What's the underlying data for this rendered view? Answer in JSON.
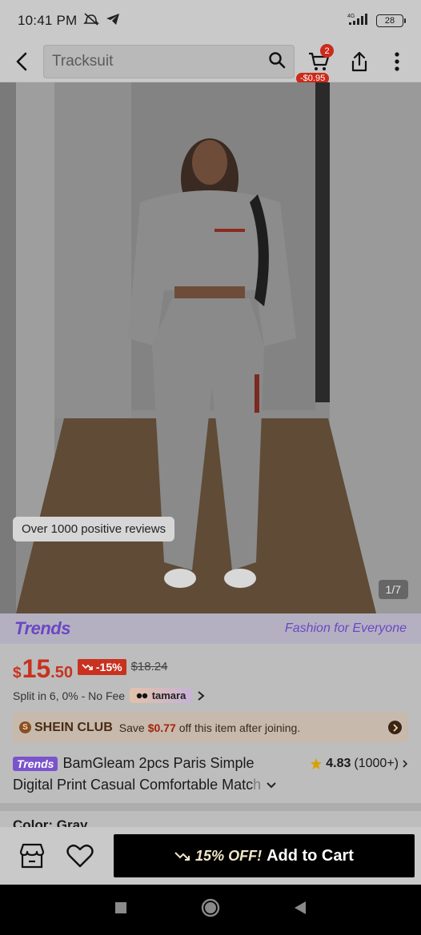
{
  "status_bar": {
    "time": "10:41 PM",
    "network": "4G",
    "battery": "28"
  },
  "search": {
    "query": "Tracksuit"
  },
  "cart": {
    "count": "2",
    "discount": "-$0.95"
  },
  "gallery": {
    "review_chip": "Over 1000 positive reviews",
    "page_indicator": "1/7"
  },
  "trends": {
    "logo": "Trends",
    "tagline": "Fashion for Everyone"
  },
  "price": {
    "currency": "$",
    "integer": "15",
    "decimal": ".50",
    "discount": "-15%",
    "original": "$18.24"
  },
  "split": {
    "text": "Split in 6, 0% - No Fee",
    "provider": "tamara"
  },
  "club": {
    "badge": "S",
    "name": "SHEIN CLUB",
    "text_before": "Save",
    "amount": "$0.77",
    "text_after": "off this item after joining."
  },
  "product": {
    "trends_chip": "Trends",
    "title_line1": "BamGleam 2pcs Paris Simple",
    "title_line2": "Digital Print Casual Comfortable Matc",
    "title_fade": "h",
    "rating": "4.83",
    "reviews": "(1000+)"
  },
  "color_label": "Color: Gray",
  "actions": {
    "cart_discount": "15% OFF!",
    "cart_label": "Add to Cart"
  },
  "colors": {
    "accent_red": "#c8321e",
    "trends_purple": "#6b47c4",
    "club_brown": "#8a4e22"
  }
}
